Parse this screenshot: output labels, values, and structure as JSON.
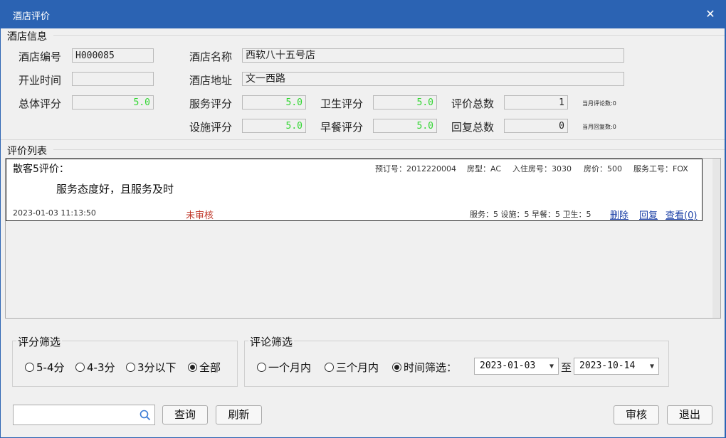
{
  "window": {
    "title": "酒店评价",
    "close_glyph": "✕"
  },
  "hotel_info": {
    "group_label": "酒店信息",
    "code_label": "酒店编号",
    "code_value": "H000085",
    "name_label": "酒店名称",
    "name_value": "西软八十五号店",
    "open_label": "开业时间",
    "open_value": "",
    "address_label": "酒店地址",
    "address_value": "文一西路",
    "overall_label": "总体评分",
    "overall_value": "5.0",
    "service_label": "服务评分",
    "service_value": "5.0",
    "hygiene_label": "卫生评分",
    "hygiene_value": "5.0",
    "total_reviews_label": "评价总数",
    "total_reviews_value": "1",
    "month_reviews_note": "当月评论数:0",
    "facility_label": "设施评分",
    "facility_value": "5.0",
    "breakfast_label": "早餐评分",
    "breakfast_value": "5.0",
    "total_replies_label": "回复总数",
    "total_replies_value": "0",
    "month_replies_note": "当月回复数:0"
  },
  "review_list": {
    "group_label": "评价列表",
    "items": [
      {
        "guest": "散客5评价：",
        "booking_no": "预订号：2012220004",
        "room_type": "房型：AC",
        "room_no": "入住房号：3030",
        "price": "房价：500",
        "staff_no": "服务工号：FOX",
        "content": "服务态度好，且服务及时",
        "time": "2023-01-03 11:13:50",
        "status": "未审核",
        "scores": "服务：5 设施：5 早餐：5 卫生：5",
        "delete_label": "删除",
        "reply_label": "回复",
        "view_label": "查看(0)"
      }
    ]
  },
  "score_filter": {
    "title": "评分筛选",
    "options": [
      "5-4分",
      "4-3分",
      "3分以下",
      "全部"
    ],
    "selected": "全部"
  },
  "comment_filter": {
    "title": "评论筛选",
    "options": [
      "一个月内",
      "三个月内",
      "时间筛选："
    ],
    "selected": "时间筛选：",
    "date_from": "2023-01-03",
    "to_label": "至",
    "date_to": "2023-10-14"
  },
  "bottom": {
    "search_placeholder": "",
    "query_label": "查询",
    "refresh_label": "刷新",
    "audit_label": "审核",
    "exit_label": "退出"
  },
  "colors": {
    "titlebar": "#2b63b3",
    "score_text": "#33d633",
    "status_text": "#c0392b",
    "link": "#1a3fa6"
  }
}
